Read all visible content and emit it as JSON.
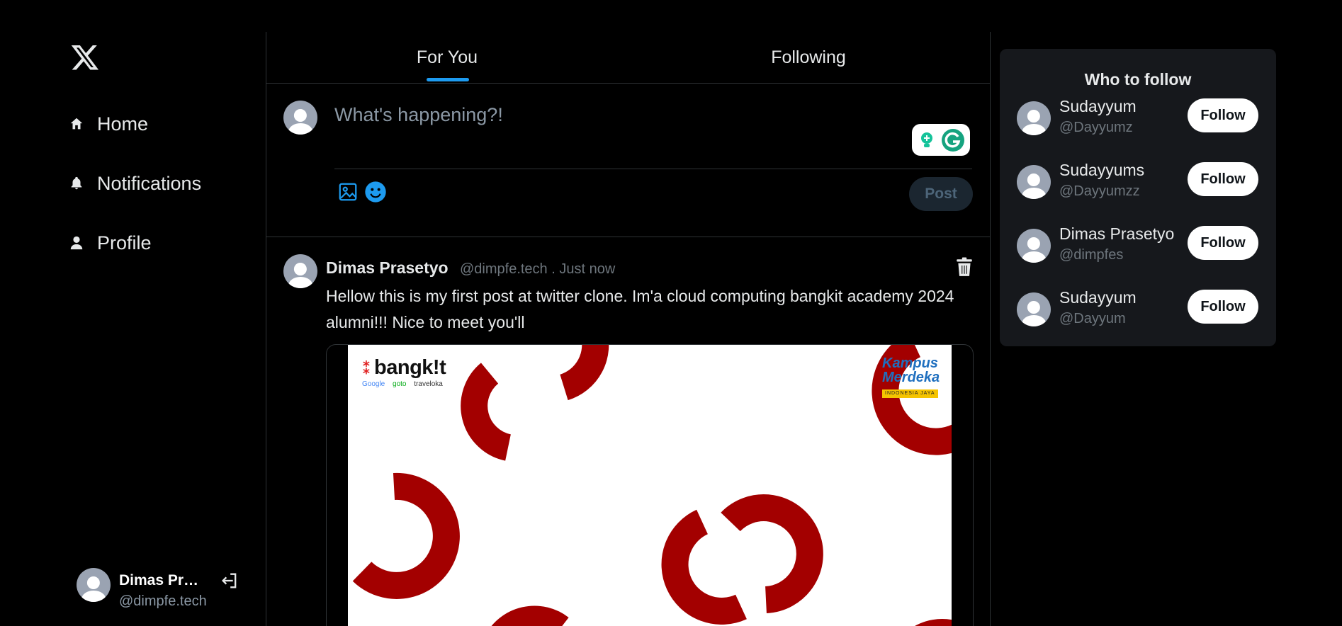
{
  "sidebar": {
    "logo_icon": "x-logo-icon",
    "nav": [
      {
        "label": "Home",
        "icon": "home-icon"
      },
      {
        "label": "Notifications",
        "icon": "bell-icon"
      },
      {
        "label": "Profile",
        "icon": "user-icon"
      }
    ],
    "account": {
      "name": "Dimas Prasetyo",
      "handle": "@dimpfe.tech",
      "logout_icon": "logout-icon"
    }
  },
  "tabs": [
    {
      "label": "For You",
      "active": true
    },
    {
      "label": "Following",
      "active": false
    }
  ],
  "composer": {
    "placeholder": "What's happening?!",
    "post_label": "Post",
    "icons": [
      "image-icon",
      "emoji-icon",
      "grammarly-icon"
    ]
  },
  "post": {
    "author": "Dimas Prasetyo",
    "meta": "@dimpfe.tech . Just now",
    "text": "Hellow this is my first post at twitter clone. Im'a cloud computing bangkit academy 2024 alumni!!! Nice to meet you'll",
    "image": {
      "brand": "bangk!t",
      "partners": [
        "Google",
        "goto",
        "traveloka"
      ],
      "kampus_line1": "Kampus",
      "kampus_line2": "Merdeka",
      "kampus_tag": "INDONESIA JAYA"
    }
  },
  "who_to_follow": {
    "title": "Who to follow",
    "follow_label": "Follow",
    "users": [
      {
        "name": "Sudayyum",
        "handle": "@Dayyumz"
      },
      {
        "name": "Sudayyums",
        "handle": "@Dayyumzz"
      },
      {
        "name": "Dimas Prasetyo",
        "handle": "@dimpfes"
      },
      {
        "name": "Sudayyum",
        "handle": "@Dayyum"
      }
    ]
  },
  "colors": {
    "background": "#000000",
    "accent": "#1d9bf0",
    "panel": "#16181c",
    "border": "#2f3336",
    "muted_text": "#6e767d",
    "brand_red": "#a30000"
  }
}
